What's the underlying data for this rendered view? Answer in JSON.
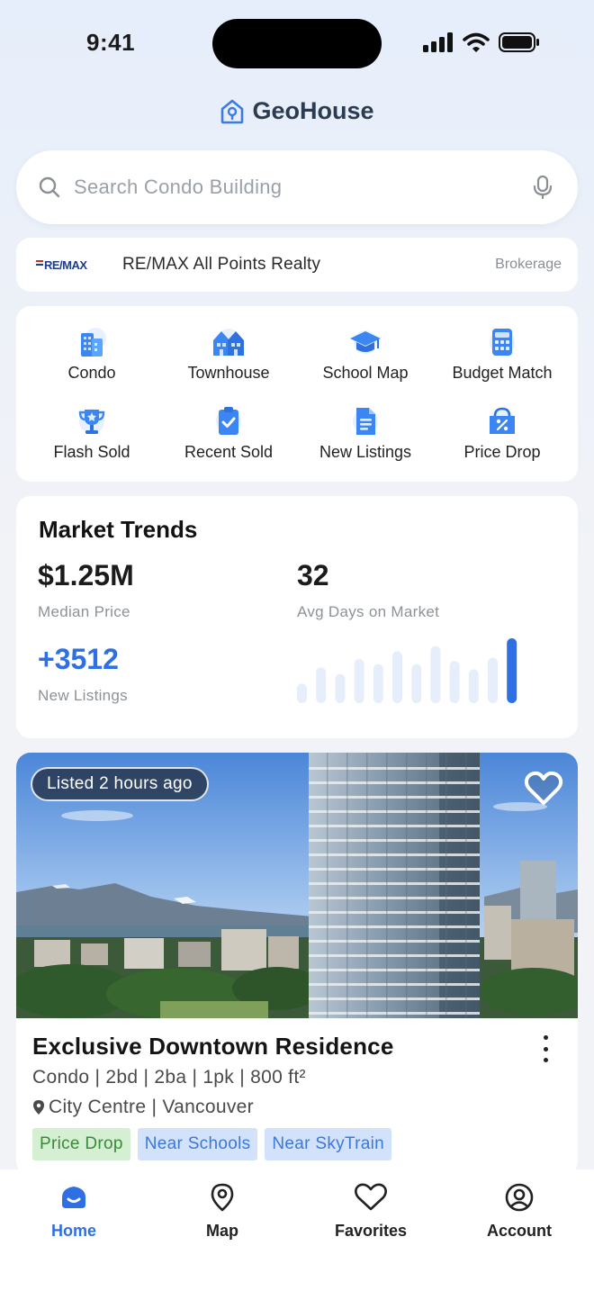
{
  "status_bar": {
    "time": "9:41"
  },
  "brand": {
    "name": "GeoHouse"
  },
  "search": {
    "placeholder": "Search Condo Building"
  },
  "brokerage": {
    "logo_text": "RE/MAX",
    "name": "RE/MAX All Points Realty",
    "tag": "Brokerage"
  },
  "categories": [
    {
      "label": "Condo",
      "icon": "building-icon"
    },
    {
      "label": "Townhouse",
      "icon": "townhouse-icon"
    },
    {
      "label": "School Map",
      "icon": "graduation-cap-icon"
    },
    {
      "label": "Budget Match",
      "icon": "calculator-icon"
    },
    {
      "label": "Flash Sold",
      "icon": "trophy-icon"
    },
    {
      "label": "Recent Sold",
      "icon": "clipboard-check-icon"
    },
    {
      "label": "New Listings",
      "icon": "document-icon"
    },
    {
      "label": "Price Drop",
      "icon": "percent-bag-icon"
    }
  ],
  "market": {
    "title": "Market Trends",
    "median_price": "$1.25M",
    "median_price_label": "Median Price",
    "avg_days": "32",
    "avg_days_label": "Avg Days on Market",
    "new_listings": "+3512",
    "new_listings_label": "New Listings",
    "trend_bars": [
      0.3,
      0.55,
      0.45,
      0.68,
      0.6,
      0.8,
      0.6,
      0.88,
      0.65,
      0.52,
      0.7,
      1.0
    ],
    "accent_color": "#2f6fe4",
    "bar_color": "#e6eefb"
  },
  "listing": {
    "listed_badge": "Listed 2 hours ago",
    "title": "Exclusive Downtown Residence",
    "specs": "Condo | 2bd | 2ba | 1pk | 800 ft²",
    "location": "City Centre | Vancouver",
    "tags": [
      {
        "label": "Price Drop",
        "style": "green"
      },
      {
        "label": "Near Schools",
        "style": "blue"
      },
      {
        "label": "Near SkyTrain",
        "style": "blue"
      }
    ]
  },
  "tabbar": {
    "items": [
      {
        "label": "Home",
        "icon": "home-icon",
        "active": true
      },
      {
        "label": "Map",
        "icon": "map-pin-icon",
        "active": false
      },
      {
        "label": "Favorites",
        "icon": "heart-icon",
        "active": false
      },
      {
        "label": "Account",
        "icon": "account-icon",
        "active": false
      }
    ]
  }
}
